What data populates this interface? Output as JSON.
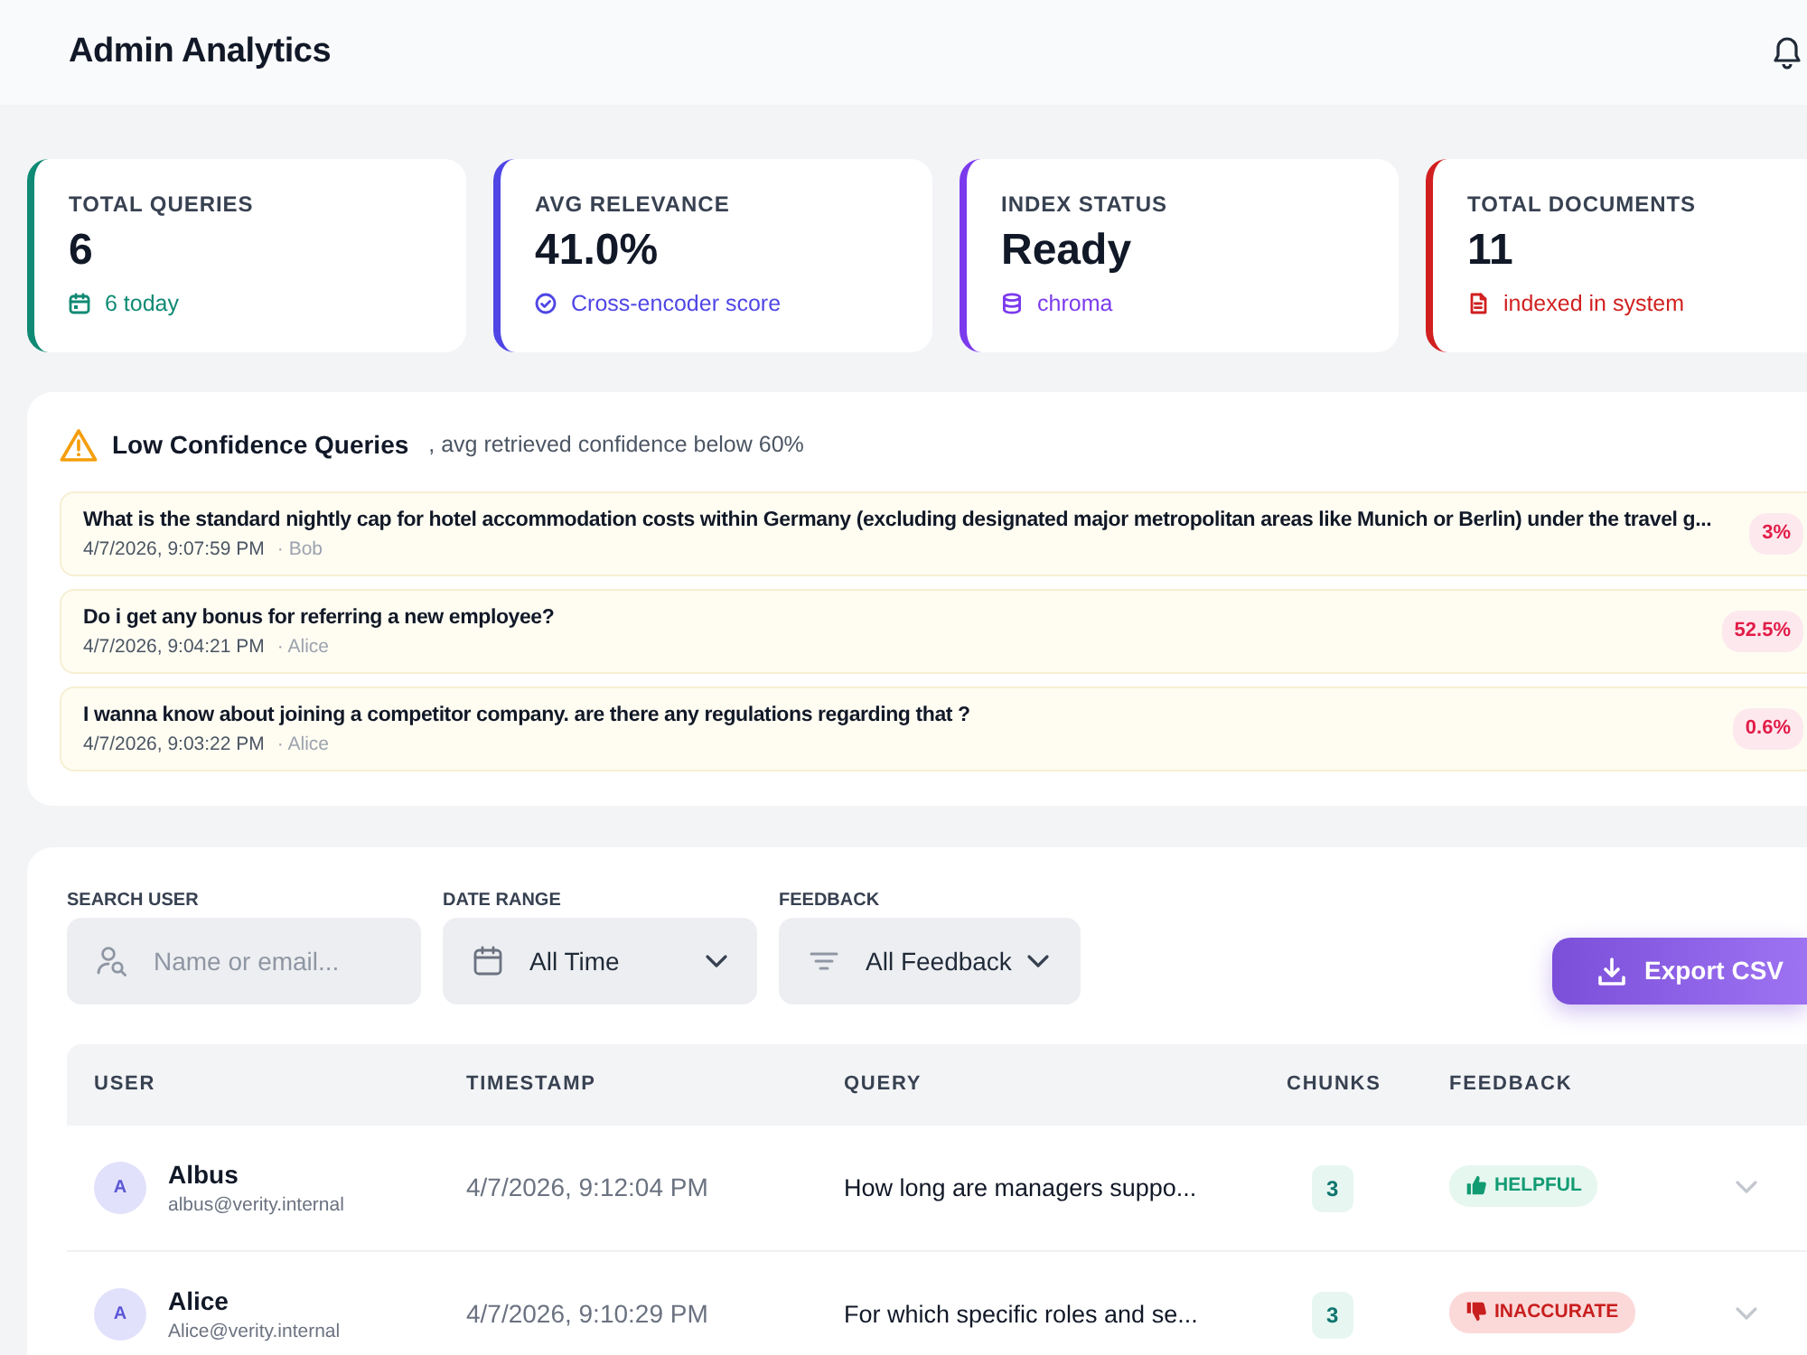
{
  "header": {
    "title": "Admin Analytics"
  },
  "stats": [
    {
      "kind": "queries",
      "label": "TOTAL QUERIES",
      "value": "6",
      "note": "6 today",
      "color": "#0f8a74"
    },
    {
      "kind": "relevance",
      "label": "AVG RELEVANCE",
      "value": "41.0%",
      "note": "Cross-encoder score",
      "color": "#4f46e5"
    },
    {
      "kind": "index",
      "label": "INDEX STATUS",
      "value": "Ready",
      "note": "chroma",
      "color": "#7c3aed"
    },
    {
      "kind": "documents",
      "label": "TOTAL DOCUMENTS",
      "value": "11",
      "note": "indexed in system",
      "color": "#d11f1f"
    }
  ],
  "low_confidence": {
    "title": "Low Confidence Queries",
    "subtitle": ", avg retrieved confidence below 60%",
    "items": [
      {
        "query": "What is the standard nightly cap for hotel accommodation costs within Germany (excluding designated major metropolitan areas like Munich or Berlin) under the travel g...",
        "time": "4/7/2026, 9:07:59 PM",
        "user": "· Bob",
        "confidence": "3%"
      },
      {
        "query": "Do i get any bonus for referring a new employee?",
        "time": "4/7/2026, 9:04:21 PM",
        "user": "· Alice",
        "confidence": "52.5%"
      },
      {
        "query": "I wanna know about joining a competitor company. are there any regulations regarding that ?",
        "time": "4/7/2026, 9:03:22 PM",
        "user": "· Alice",
        "confidence": "0.6%"
      }
    ]
  },
  "filters": [
    {
      "kind": "search",
      "label": "SEARCH USER",
      "placeholder": "Name or email..."
    },
    {
      "kind": "date",
      "label": "DATE RANGE",
      "value": "All Time"
    },
    {
      "kind": "feedback",
      "label": "FEEDBACK",
      "value": "All Feedback"
    }
  ],
  "export_button": "Export CSV",
  "table": {
    "columns": [
      "USER",
      "TIMESTAMP",
      "QUERY",
      "CHUNKS",
      "FEEDBACK"
    ],
    "rows": [
      {
        "avatar": "A",
        "name": "Albus",
        "email": "albus@verity.internal",
        "timestamp": "4/7/2026, 9:12:04 PM",
        "query": "How long are managers suppo...",
        "chunks": "3",
        "feedback": {
          "kind": "helpful",
          "label": "HELPFUL"
        }
      },
      {
        "avatar": "A",
        "name": "Alice",
        "email": "Alice@verity.internal",
        "timestamp": "4/7/2026, 9:10:29 PM",
        "query": "For which specific roles and se...",
        "chunks": "3",
        "feedback": {
          "kind": "inaccurate",
          "label": "INACCURATE"
        }
      }
    ]
  }
}
